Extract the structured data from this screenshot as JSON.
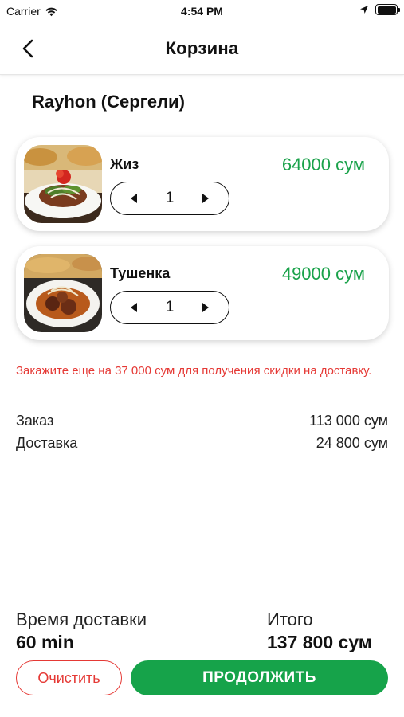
{
  "status_bar": {
    "carrier": "Carrier",
    "time": "4:54 PM",
    "icons": [
      "wifi-icon",
      "location-arrow-icon",
      "battery-icon"
    ]
  },
  "nav": {
    "title": "Корзина",
    "back_icon": "chevron-left-icon"
  },
  "restaurant": "Rayhon (Сергели)",
  "items": [
    {
      "name": "Жиз",
      "price": "64000 сум",
      "quantity": "1"
    },
    {
      "name": "Тушенка",
      "price": "49000 сум",
      "quantity": "1"
    }
  ],
  "discount_note": "Закажите еще на 37 000 сум для получения скидки на доставку.",
  "summary": {
    "order_label": "Заказ",
    "order_value": "113 000 сум",
    "delivery_label": "Доставка",
    "delivery_value": "24 800 сум"
  },
  "footer": {
    "delivery_time_label": "Время доставки",
    "delivery_time_value": "60 min",
    "total_label": "Итого",
    "total_value": "137 800 сум",
    "clear_label": "Очистить",
    "continue_label": "ПРОДОЛЖИТЬ"
  },
  "colors": {
    "accent_green": "#16a34a",
    "price_green": "#1aa24a",
    "warning_red": "#e53935"
  }
}
